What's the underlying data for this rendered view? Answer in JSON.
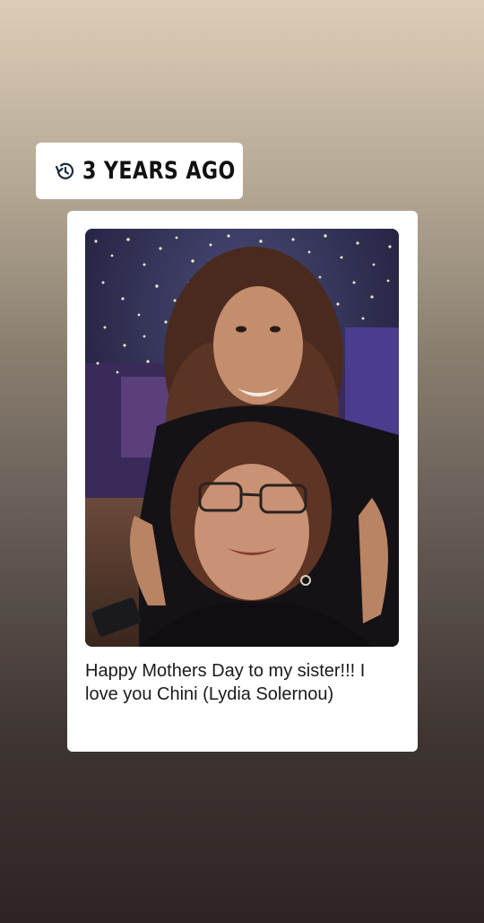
{
  "memory": {
    "label": "3 YEARS AGO",
    "icon": "history-clock-icon"
  },
  "post": {
    "caption": "Happy Mothers Day to my sister!!! I love you Chini (Lydia Solernou)",
    "photo_subject": "selfie-photo"
  },
  "colors": {
    "background_top": "#dccdb7",
    "background_bottom": "#2e2424",
    "card": "#ffffff",
    "text": "#1a1a1a"
  }
}
